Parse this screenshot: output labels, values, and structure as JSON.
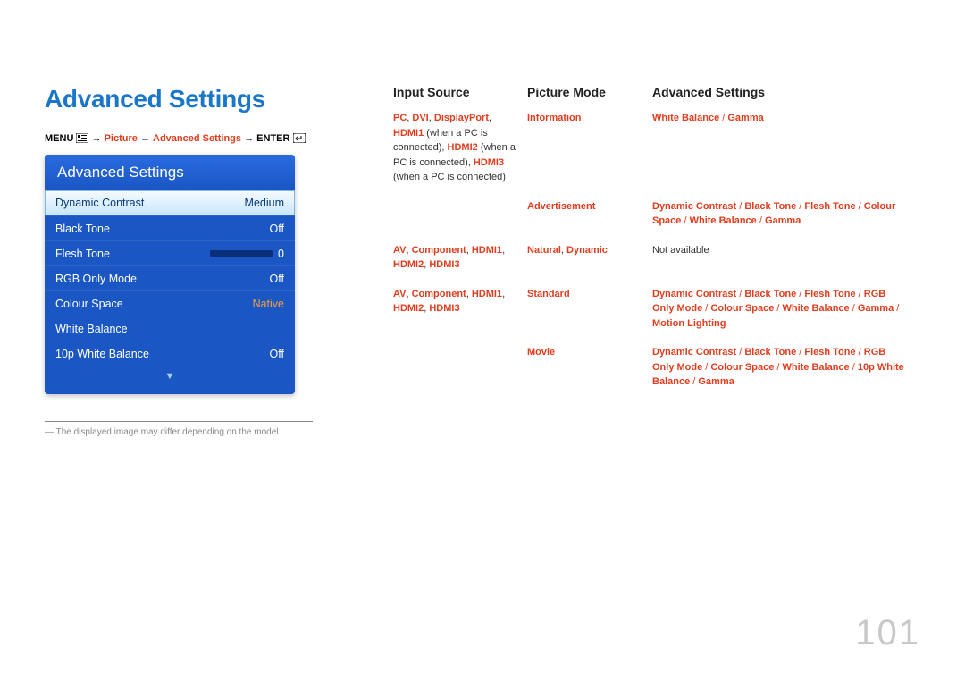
{
  "pageNumber": "101",
  "sectionTitle": "Advanced Settings",
  "breadcrumb": {
    "menu": "MENU",
    "arrow": "→",
    "picture": "Picture",
    "advanced": "Advanced Settings",
    "enter": "ENTER"
  },
  "osd": {
    "title": "Advanced Settings",
    "rows": [
      {
        "label": "Dynamic Contrast",
        "value": "Medium",
        "sel": true
      },
      {
        "label": "Black Tone",
        "value": "Off"
      },
      {
        "label": "Flesh Tone",
        "value": "0",
        "slider": true
      },
      {
        "label": "RGB Only Mode",
        "value": "Off"
      },
      {
        "label": "Colour Space",
        "value": "Native",
        "native": true
      },
      {
        "label": "White Balance",
        "value": ""
      },
      {
        "label": "10p White Balance",
        "value": "Off"
      }
    ]
  },
  "footnote": "The displayed image may differ depending on the model.",
  "table": {
    "headers": {
      "c1": "Input Source",
      "c2": "Picture Mode",
      "c3": "Advanced Settings"
    },
    "rows": [
      {
        "c1_html": [
          {
            "t": "PC",
            "c": "redb"
          },
          {
            "t": ", ",
            "c": "norm"
          },
          {
            "t": "DVI",
            "c": "redb"
          },
          {
            "t": ", ",
            "c": "norm"
          },
          {
            "t": "DisplayPort",
            "c": "redb"
          },
          {
            "t": ", ",
            "c": "norm"
          },
          {
            "t": "HDMI1",
            "c": "redb"
          },
          {
            "t": " (when a PC is connected), ",
            "c": "norm"
          },
          {
            "t": "HDMI2",
            "c": "redb"
          },
          {
            "t": " (when a PC is connected), ",
            "c": "norm"
          },
          {
            "t": "HDMI3",
            "c": "redb"
          },
          {
            "t": " (when a PC is connected)",
            "c": "norm"
          }
        ],
        "sub": [
          {
            "c2": [
              {
                "t": "Information",
                "c": "redb"
              }
            ],
            "c3": [
              {
                "t": "White Balance",
                "c": "redb"
              },
              {
                "t": " / ",
                "c": "sep"
              },
              {
                "t": "Gamma",
                "c": "redb"
              }
            ]
          },
          {
            "c2": [
              {
                "t": "Advertisement",
                "c": "redb"
              }
            ],
            "c3": [
              {
                "t": "Dynamic Contrast",
                "c": "redb"
              },
              {
                "t": " / ",
                "c": "sep"
              },
              {
                "t": "Black Tone",
                "c": "redb"
              },
              {
                "t": " / ",
                "c": "sep"
              },
              {
                "t": "Flesh Tone",
                "c": "redb"
              },
              {
                "t": " / ",
                "c": "sep"
              },
              {
                "t": "Colour Space",
                "c": "redb"
              },
              {
                "t": " / ",
                "c": "sep"
              },
              {
                "t": "White Balance",
                "c": "redb"
              },
              {
                "t": " / ",
                "c": "sep"
              },
              {
                "t": "Gamma",
                "c": "redb"
              }
            ]
          }
        ]
      },
      {
        "c1_html": [
          {
            "t": "AV",
            "c": "redb"
          },
          {
            "t": ", ",
            "c": "norm"
          },
          {
            "t": "Component",
            "c": "redb"
          },
          {
            "t": ", ",
            "c": "norm"
          },
          {
            "t": "HDMI1",
            "c": "redb"
          },
          {
            "t": ", ",
            "c": "norm"
          },
          {
            "t": "HDMI2",
            "c": "redb"
          },
          {
            "t": ", ",
            "c": "norm"
          },
          {
            "t": "HDMI3",
            "c": "redb"
          }
        ],
        "sub": [
          {
            "c2": [
              {
                "t": "Natural",
                "c": "redb"
              },
              {
                "t": ", ",
                "c": "norm"
              },
              {
                "t": "Dynamic",
                "c": "redb"
              }
            ],
            "c3": [
              {
                "t": "Not available",
                "c": "norm"
              }
            ]
          }
        ]
      },
      {
        "c1_html": [
          {
            "t": "AV",
            "c": "redb"
          },
          {
            "t": ", ",
            "c": "norm"
          },
          {
            "t": "Component",
            "c": "redb"
          },
          {
            "t": ", ",
            "c": "norm"
          },
          {
            "t": "HDMI1",
            "c": "redb"
          },
          {
            "t": ", ",
            "c": "norm"
          },
          {
            "t": "HDMI2",
            "c": "redb"
          },
          {
            "t": ", ",
            "c": "norm"
          },
          {
            "t": "HDMI3",
            "c": "redb"
          }
        ],
        "sub": [
          {
            "c2": [
              {
                "t": "Standard",
                "c": "redb"
              }
            ],
            "c3": [
              {
                "t": "Dynamic Contrast",
                "c": "redb"
              },
              {
                "t": " / ",
                "c": "sep"
              },
              {
                "t": "Black Tone",
                "c": "redb"
              },
              {
                "t": " / ",
                "c": "sep"
              },
              {
                "t": "Flesh Tone",
                "c": "redb"
              },
              {
                "t": " / ",
                "c": "sep"
              },
              {
                "t": "RGB Only Mode",
                "c": "redb"
              },
              {
                "t": " / ",
                "c": "sep"
              },
              {
                "t": "Colour Space",
                "c": "redb"
              },
              {
                "t": " / ",
                "c": "sep"
              },
              {
                "t": "White Balance",
                "c": "redb"
              },
              {
                "t": " / ",
                "c": "sep"
              },
              {
                "t": "Gamma",
                "c": "redb"
              },
              {
                "t": " / ",
                "c": "sep"
              },
              {
                "t": "Motion Lighting",
                "c": "redb"
              }
            ]
          },
          {
            "c2": [
              {
                "t": "Movie",
                "c": "redb"
              }
            ],
            "c3": [
              {
                "t": "Dynamic Contrast",
                "c": "redb"
              },
              {
                "t": " / ",
                "c": "sep"
              },
              {
                "t": "Black Tone",
                "c": "redb"
              },
              {
                "t": " / ",
                "c": "sep"
              },
              {
                "t": "Flesh Tone",
                "c": "redb"
              },
              {
                "t": " / ",
                "c": "sep"
              },
              {
                "t": "RGB Only Mode",
                "c": "redb"
              },
              {
                "t": " / ",
                "c": "sep"
              },
              {
                "t": "Colour Space",
                "c": "redb"
              },
              {
                "t": " / ",
                "c": "sep"
              },
              {
                "t": "White Balance",
                "c": "redb"
              },
              {
                "t": " / ",
                "c": "sep"
              },
              {
                "t": "10p White Balance",
                "c": "redb"
              },
              {
                "t": " / ",
                "c": "sep"
              },
              {
                "t": "Gamma",
                "c": "redb"
              }
            ]
          }
        ]
      }
    ]
  }
}
